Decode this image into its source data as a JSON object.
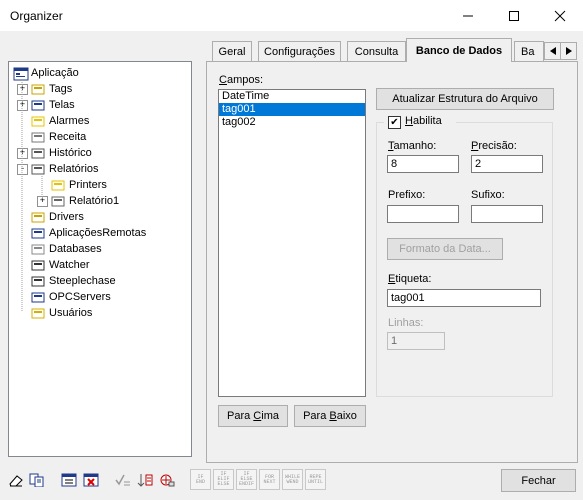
{
  "window": {
    "title": "Organizer",
    "minimize_icon": "minimize-icon",
    "maximize_icon": "maximize-icon",
    "close_icon": "close-icon"
  },
  "tree": {
    "root": "Aplicação",
    "items": [
      {
        "label": "Tags",
        "icon": "tags-icon",
        "expander": "+"
      },
      {
        "label": "Telas",
        "icon": "screens-icon",
        "expander": "+"
      },
      {
        "label": "Alarmes",
        "icon": "alarm-icon",
        "expander": ""
      },
      {
        "label": "Receita",
        "icon": "recipe-icon",
        "expander": ""
      },
      {
        "label": "Histórico",
        "icon": "history-icon",
        "expander": "+"
      },
      {
        "label": "Relatórios",
        "icon": "reports-icon",
        "expander": "-"
      },
      {
        "label": "Printers",
        "icon": "folder-icon",
        "expander": ""
      },
      {
        "label": "Relatório1",
        "icon": "report-icon",
        "expander": "+"
      },
      {
        "label": "Drivers",
        "icon": "drivers-icon",
        "expander": ""
      },
      {
        "label": "AplicaçõesRemotas",
        "icon": "remote-apps-icon",
        "expander": ""
      },
      {
        "label": "Databases",
        "icon": "database-icon",
        "expander": ""
      },
      {
        "label": "Watcher",
        "icon": "watcher-icon",
        "expander": ""
      },
      {
        "label": "Steeplechase",
        "icon": "steeplechase-icon",
        "expander": ""
      },
      {
        "label": "OPCServers",
        "icon": "opc-icon",
        "expander": ""
      },
      {
        "label": "Usuários",
        "icon": "users-icon",
        "expander": ""
      }
    ]
  },
  "tabs": [
    "Geral",
    "Configurações",
    "Consulta",
    "Banco de Dados",
    "Ba"
  ],
  "active_tab": "Banco de Dados",
  "campos": {
    "label": "Campos:",
    "items": [
      "DateTime",
      "tag001",
      "tag002"
    ],
    "selected": "tag001"
  },
  "buttons": {
    "update": "Atualizar Estrutura do Arquivo",
    "date_format": "Formato da Data...",
    "up": "Para Cima",
    "down": "Para Baixo",
    "close": "Fechar"
  },
  "habilita": {
    "label": "Habilita",
    "checked": "✔"
  },
  "fields": {
    "tamanho_label": "Tamanho:",
    "tamanho_value": "8",
    "precisao_label": "Precisão:",
    "precisao_value": "2",
    "prefixo_label": "Prefixo:",
    "prefixo_value": "",
    "sufixo_label": "Sufixo:",
    "sufixo_value": "",
    "etiqueta_label": "Etiqueta:",
    "etiqueta_value": "tag001",
    "linhas_label": "Linhas:",
    "linhas_value": "1"
  },
  "toolbar_text_buttons": [
    [
      "IF",
      "END"
    ],
    [
      "IF",
      "ELIF",
      "ELSE"
    ],
    [
      "IF",
      "ELSE",
      "ENDIF"
    ],
    [
      "FOR",
      "NEXT"
    ],
    [
      "WHILE",
      "WEND"
    ],
    [
      "REPE",
      "UNTIL"
    ]
  ]
}
